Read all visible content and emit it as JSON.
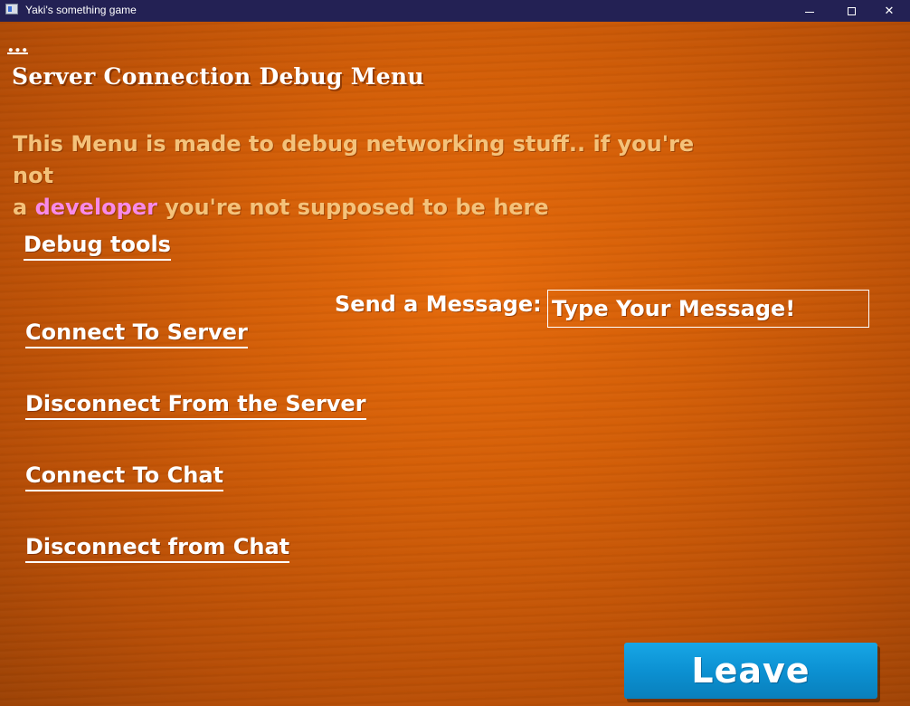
{
  "window": {
    "title": "Yaki's something game",
    "minimize_icon": "minimize-icon",
    "maximize_icon": "maximize-icon",
    "close_icon": "close-icon",
    "close_glyph": "✕"
  },
  "page": {
    "ellipsis": "...",
    "heading": "Server Connection Debug Menu",
    "notice_line1": "This Menu is made to debug networking stuff.. if you're not",
    "notice_line2_prefix": "a ",
    "notice_highlight": "developer",
    "notice_line2_suffix": " you're not supposed to be here"
  },
  "menu": {
    "debug_tools": "Debug tools",
    "connect_server": "Connect To Server",
    "disconnect_server": "Disconnect From the Server",
    "connect_chat": "Connect To Chat",
    "disconnect_chat": "Disconnect from Chat"
  },
  "message": {
    "label": "Send a Message:",
    "placeholder": "Type Your Message!",
    "value": ""
  },
  "leave_button": "Leave",
  "colors": {
    "background": "#d35e07",
    "notice_text": "#f4c27a",
    "highlight": "#f88ae8",
    "leave_button": "#0b8fd0",
    "titlebar": "#232154"
  }
}
